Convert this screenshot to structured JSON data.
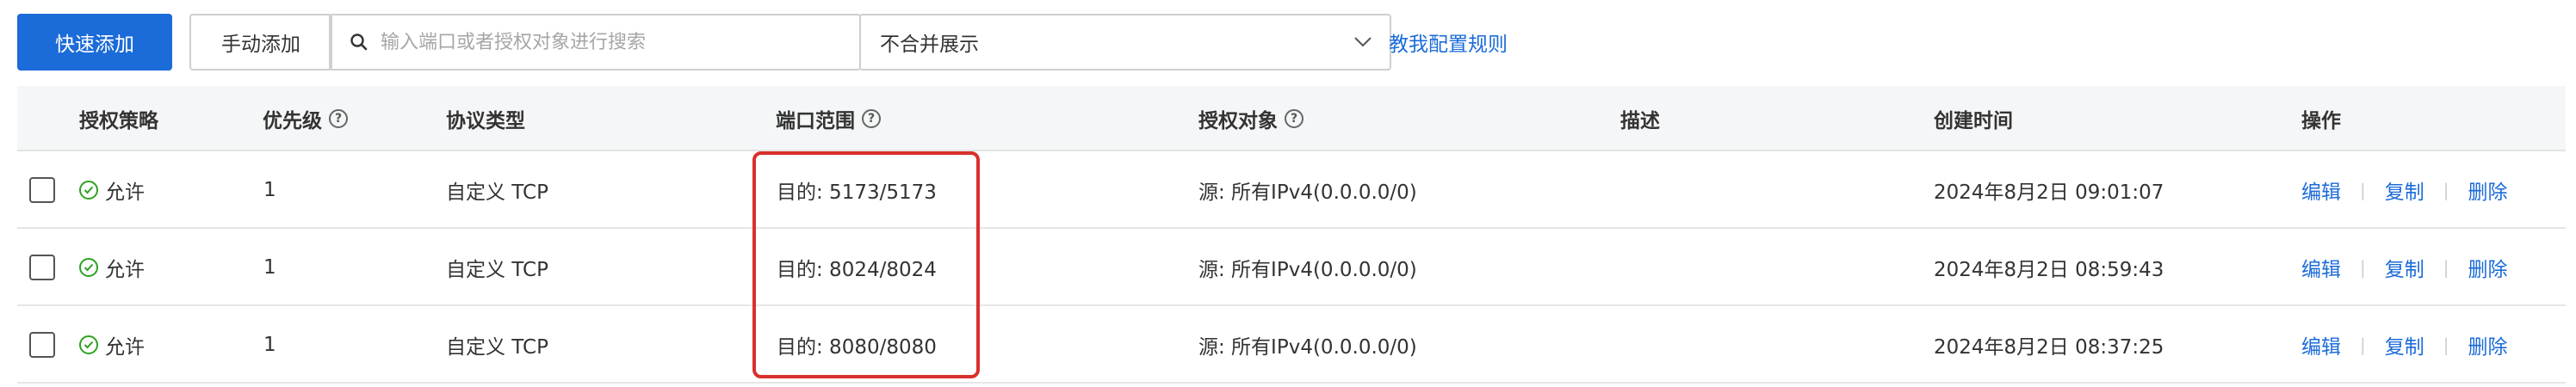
{
  "toolbar": {
    "quick_add": "快速添加",
    "manual_add": "手动添加",
    "search_placeholder": "输入端口或者授权对象进行搜索",
    "display_mode": "不合并展示",
    "help_link": "教我配置规则"
  },
  "columns": {
    "policy": "授权策略",
    "priority": "优先级",
    "protocol": "协议类型",
    "port_range": "端口范围",
    "auth_object": "授权对象",
    "description": "描述",
    "created": "创建时间",
    "actions": "操作"
  },
  "rows": [
    {
      "policy": "允许",
      "priority": "1",
      "protocol": "自定义 TCP",
      "port_range": "目的: 5173/5173",
      "auth_object": "源: 所有IPv4(0.0.0.0/0)",
      "description": "",
      "created": "2024年8月2日 09:01:07"
    },
    {
      "policy": "允许",
      "priority": "1",
      "protocol": "自定义 TCP",
      "port_range": "目的: 8024/8024",
      "auth_object": "源: 所有IPv4(0.0.0.0/0)",
      "description": "",
      "created": "2024年8月2日 08:59:43"
    },
    {
      "policy": "允许",
      "priority": "1",
      "protocol": "自定义 TCP",
      "port_range": "目的: 8080/8080",
      "auth_object": "源: 所有IPv4(0.0.0.0/0)",
      "description": "",
      "created": "2024年8月2日 08:37:25"
    }
  ],
  "row_actions": {
    "edit": "编辑",
    "copy": "复制",
    "delete": "删除"
  },
  "icons": {
    "search": "search-icon",
    "dropdown": "chevron-down-icon",
    "help": "question-circle-icon",
    "allow": "check-circle-icon"
  },
  "colors": {
    "primary": "#1b6bd8",
    "allow_green": "#2ea121",
    "highlight_red": "#d9302c",
    "header_bg": "#f5f6f7"
  }
}
